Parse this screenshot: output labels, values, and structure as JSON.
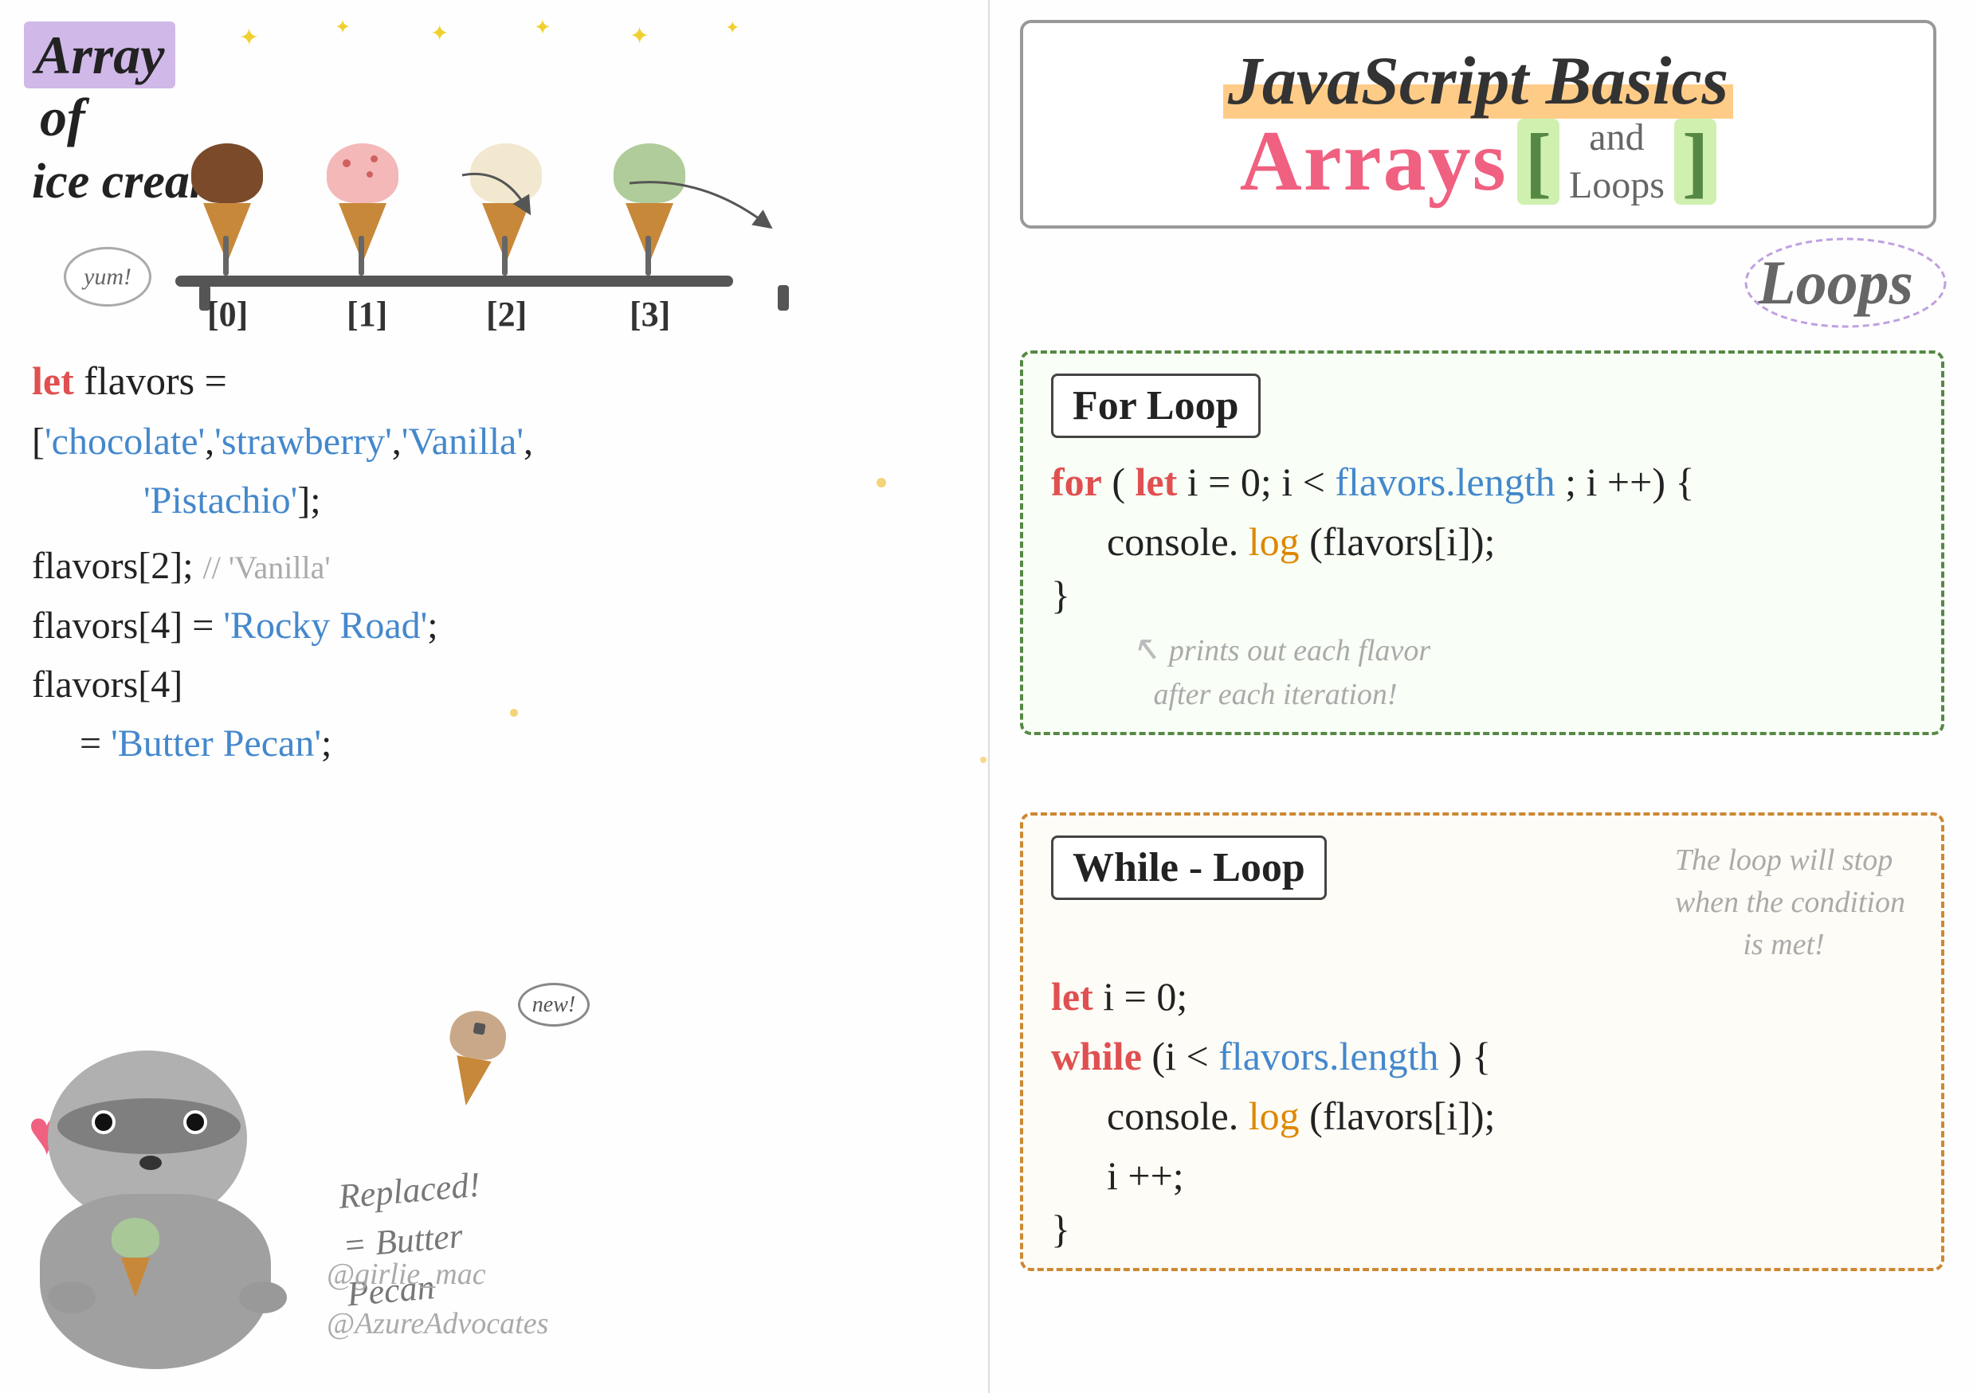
{
  "title": "JavaScript Basics Arrays and Loops",
  "left": {
    "array_title_line1": "Array",
    "array_title_line2": "of",
    "array_title_line3": "ice cream",
    "yum": "yum!",
    "indices": [
      "[0]",
      "[1]",
      "[2]",
      "[3]"
    ],
    "code_lines": [
      {
        "text": "let flavors =",
        "parts": [
          {
            "t": "let",
            "cls": "kw-let"
          },
          {
            "t": " flavors =",
            "cls": "kw-dark"
          }
        ]
      },
      {
        "text": "['chocolate','strawberry','Vanilla',",
        "parts": [
          {
            "t": "[",
            "cls": "kw-dark"
          },
          {
            "t": "'chocolate'",
            "cls": "kw-blue"
          },
          {
            "t": ",",
            "cls": "kw-dark"
          },
          {
            "t": "'strawberry'",
            "cls": "kw-blue"
          },
          {
            "t": ",",
            "cls": "kw-dark"
          },
          {
            "t": "'Vanilla'",
            "cls": "kw-blue"
          },
          {
            "t": ",",
            "cls": "kw-dark"
          }
        ]
      },
      {
        "text": "  'Pistachio'];",
        "parts": [
          {
            "t": "  ",
            "cls": "kw-dark"
          },
          {
            "t": "'Pistachio'",
            "cls": "kw-blue"
          },
          {
            "t": "];",
            "cls": "kw-dark"
          }
        ]
      },
      {
        "text": "flavors[2]; // 'Vanilla'",
        "parts": [
          {
            "t": "flavors[2];",
            "cls": "kw-dark"
          },
          {
            "t": " // 'Vanilla'",
            "cls": "kw-gray"
          }
        ]
      },
      {
        "text": "flavors[4] = 'Rocky Road';",
        "parts": [
          {
            "t": "flavors[4] = ",
            "cls": "kw-dark"
          },
          {
            "t": "'Rocky Road'",
            "cls": "kw-blue"
          },
          {
            "t": ";",
            "cls": "kw-dark"
          }
        ]
      },
      {
        "text": "flavors[4]",
        "parts": [
          {
            "t": "flavors[4]",
            "cls": "kw-dark"
          }
        ]
      },
      {
        "text": "  = 'Butter Pecan';",
        "parts": [
          {
            "t": "  = ",
            "cls": "kw-dark"
          },
          {
            "t": "'Butter Pecan'",
            "cls": "kw-blue"
          },
          {
            "t": ";",
            "cls": "kw-dark"
          }
        ]
      }
    ],
    "watermark_line1": "@girlie_mac",
    "watermark_line2": "@AzureAdvocates",
    "replaced_text": "Replaced!\n= Butter\n  Pecan",
    "new_label": "new!"
  },
  "right": {
    "js_basics": "JavaScript Basics",
    "arrays_label": "Arrays",
    "bracket_open": "[",
    "and_loops": "and\nLoops",
    "bracket_close": "]",
    "loops_heading": "Loops",
    "for_loop_title": "For Loop",
    "for_loop_code": [
      "for (let i = 0; i < flavors.length; i++) {",
      "  console.log (flavors[i]);",
      "}"
    ],
    "for_loop_comment": "prints out each flavor\nafter each iteration!",
    "while_loop_title": "While - Loop",
    "while_loop_code": [
      "let i = 0;",
      "while (i < flavors.length) {",
      "  console.log (flavors[i]);",
      "  i++;",
      "}"
    ],
    "while_loop_annotation": "The loop will stop\nwhen the condition\nis met!"
  }
}
